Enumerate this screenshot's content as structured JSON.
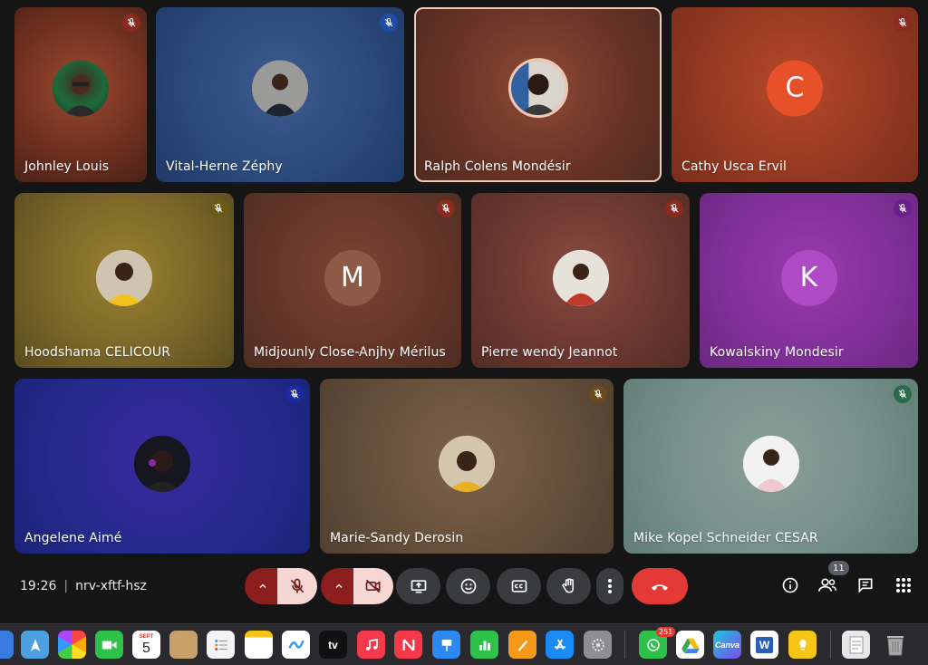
{
  "meeting": {
    "time": "19:26",
    "separator": "|",
    "code": "nrv-xftf-hsz"
  },
  "participants": [
    {
      "name": "Johnley Louis",
      "avatar": "photo",
      "muted": true,
      "mute_color": "#8b2a1e"
    },
    {
      "name": "Vital-Herne Zéphy",
      "avatar": "photo",
      "muted": true,
      "mute_color": "#1e4aa8"
    },
    {
      "name": "Ralph Colens Mondésir",
      "avatar": "photo",
      "muted": false,
      "active_speaker": true
    },
    {
      "name": "Cathy Usca Ervil",
      "avatar": "letter",
      "letter": "C",
      "muted": true,
      "mute_color": "#8b2a1e"
    },
    {
      "name": "Hoodshama CELICOUR",
      "avatar": "photo",
      "muted": true,
      "mute_color": "#6a5a14"
    },
    {
      "name": "Midjounly Close-Anjhy Mérilus",
      "avatar": "letter",
      "letter": "M",
      "muted": true,
      "mute_color": "#8b2a1e"
    },
    {
      "name": "Pierre wendy Jeannot",
      "avatar": "photo",
      "muted": true,
      "mute_color": "#8b2a1e"
    },
    {
      "name": "Kowalskiny Mondesir",
      "avatar": "letter",
      "letter": "K",
      "muted": true,
      "mute_color": "#6a1f8a"
    },
    {
      "name": "Angelene Aimé",
      "avatar": "photo",
      "muted": true,
      "mute_color": "#1a2aa0"
    },
    {
      "name": "Marie-Sandy Derosin",
      "avatar": "photo",
      "muted": true,
      "mute_color": "#6a4a1e"
    },
    {
      "name": "Mike Kopel Schneider CESAR",
      "avatar": "photo",
      "muted": true,
      "mute_color": "#2a6a4a"
    }
  ],
  "controls": {
    "people_count": "11"
  },
  "dock": {
    "calendar_month": "SEPT",
    "calendar_day": "5",
    "tv_label": "tv",
    "whatsapp_badge": "251",
    "canva_label": "Canva",
    "word_label": "W"
  },
  "colors": {
    "hangup": "#e53935",
    "mic_off_bg": "#8c1e1e",
    "mic_off_fg": "#f6d7d4",
    "control_gray": "#3a3b3f"
  }
}
